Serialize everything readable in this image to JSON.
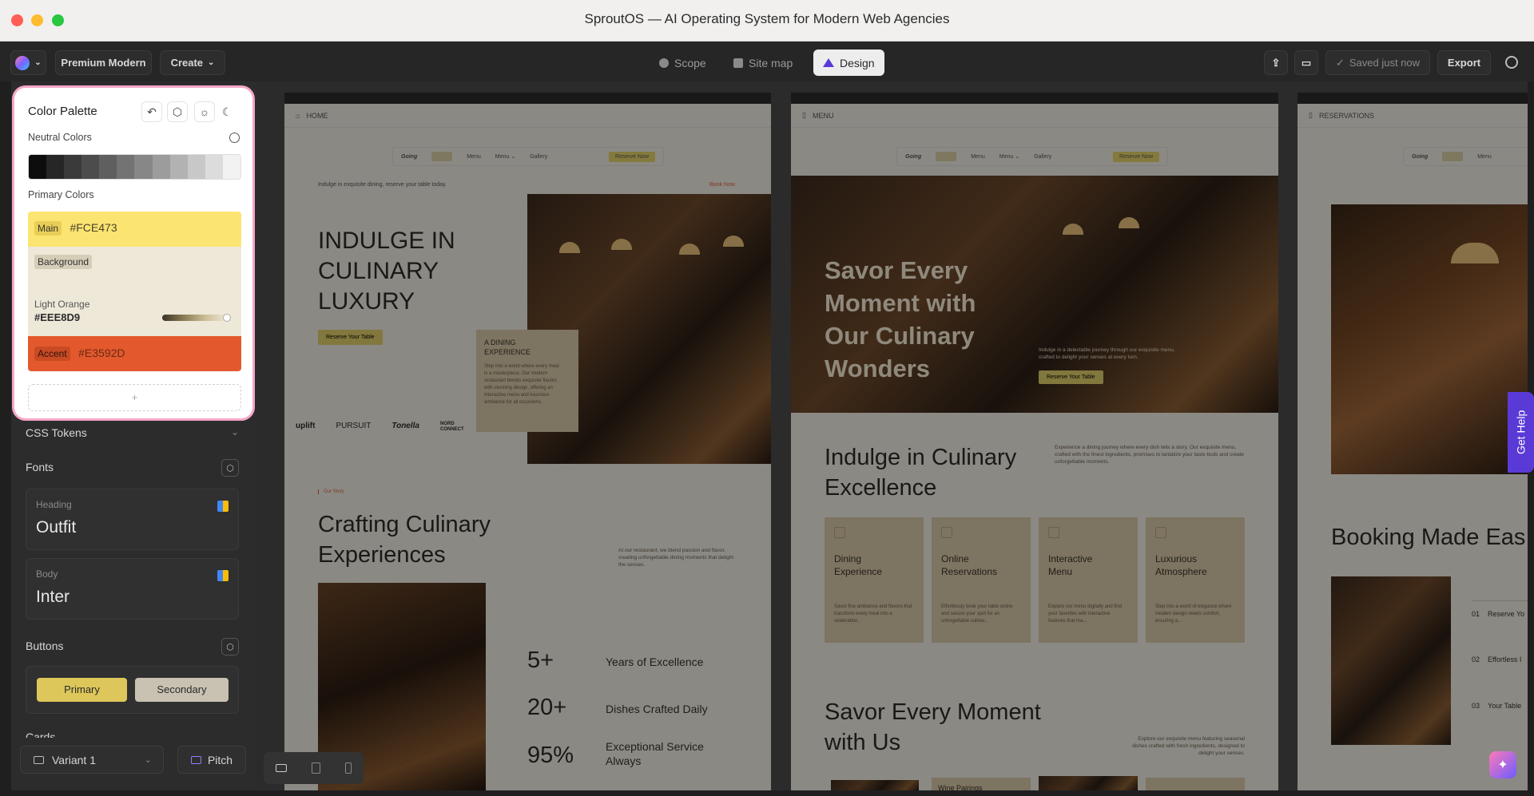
{
  "window": {
    "title": "SproutOS — AI Operating System for Modern Web Agencies"
  },
  "toolbar": {
    "theme_label": "Premium Modern",
    "create_label": "Create",
    "tabs": [
      "Scope",
      "Site map",
      "Design"
    ],
    "active_tab": "Design",
    "saved_label": "Saved just now",
    "export_label": "Export"
  },
  "palette": {
    "title": "Color Palette",
    "neutral_label": "Neutral Colors",
    "neutrals": [
      "#0d0d0d",
      "#262626",
      "#3a3a3a",
      "#4c4c4c",
      "#5f5f5f",
      "#737373",
      "#878787",
      "#9c9c9c",
      "#b2b2b2",
      "#c8c8c8",
      "#dcdcdc",
      "#f2f2f2"
    ],
    "primary_label": "Primary Colors",
    "main_pill": "Main",
    "main_hex": "#FCE473",
    "bg_pill": "Background",
    "bg_name": "Light Orange",
    "bg_hex": "#EEE8D9",
    "accent_pill": "Accent",
    "accent_hex": "#E3592D",
    "add_label": "+"
  },
  "sidebar": {
    "css_tokens": "CSS Tokens",
    "fonts": "Fonts",
    "heading_label": "Heading",
    "heading_font": "Outfit",
    "body_label": "Body",
    "body_font": "Inter",
    "buttons": "Buttons",
    "primary_btn": "Primary",
    "secondary_btn": "Secondary",
    "cards": "Cards",
    "variant_label": "Variant 1",
    "pitch_label": "Pitch"
  },
  "pages": {
    "home": {
      "tab": "HOME",
      "logo": "Going",
      "nav": [
        "Menu",
        "Menu ⌄",
        "Gallery"
      ],
      "cta": "Reserve Now",
      "note": "Indulge in exquisite dining, reserve your table today.",
      "book": "Book Now",
      "hero": "INDULGE IN CULINARY LUXURY",
      "hero_btn": "Reserve Your Table",
      "dining_title": "A DINING EXPERIENCE",
      "dining_body": "Step into a world where every meal is a masterpiece. Our modern restaurant blends exquisite flavors with stunning design, offering an interactive menu and luxurious ambiance for all occasions.",
      "brands": [
        "uplift",
        "PURSUIT",
        "Tonella",
        "NORD CONNECT"
      ],
      "story_tag": "Our Story",
      "craft_title": "Crafting Culinary Experiences",
      "craft_body": "At our restaurant, we blend passion and flavor, creating unforgettable dining moments that delight the senses.",
      "stats": [
        {
          "num": "5+",
          "label": "Years of Excellence"
        },
        {
          "num": "20+",
          "label": "Dishes Crafted Daily"
        },
        {
          "num": "95%",
          "label": "Exceptional Service Always"
        }
      ]
    },
    "menu": {
      "tab": "MENU",
      "logo": "Going",
      "nav": [
        "Menu",
        "Menu ⌄",
        "Gallery"
      ],
      "cta": "Reserve Now",
      "hero": "Savor Every Moment with Our Culinary Wonders",
      "hero_body": "Indulge in a delectable journey through our exquisite menu, crafted to delight your senses at every turn.",
      "hero_btn": "Reserve Your Table",
      "indulge_title": "Indulge in Culinary Excellence",
      "indulge_body": "Experience a dining journey where every dish tells a story. Our exquisite menu, crafted with the finest ingredients, promises to tantalize your taste buds and create unforgettable moments.",
      "features": [
        {
          "title": "Dining Experience",
          "body": "Savor fine ambiance and flavors that transform every meal into a celebration."
        },
        {
          "title": "Online Reservations",
          "body": "Effortlessly book your table online and secure your spot for an unforgettable culinar..."
        },
        {
          "title": "Interactive Menu",
          "body": "Explore our menu digitally and find your favorites with interactive features that ma..."
        },
        {
          "title": "Luxurious Atmosphere",
          "body": "Step into a world of elegance where modern design meets comfort, ensuring a..."
        }
      ],
      "savor_title": "Savor Every Moment with Us",
      "savor_body": "Explore our exquisite menu featuring seasonal dishes crafted with fresh ingredients, designed to delight your senses.",
      "wine": "Wine Pairings"
    },
    "reservations": {
      "tab": "RESERVATIONS",
      "logo": "Going",
      "nav": [
        "Menu"
      ],
      "booking_title": "Booking Made Eas",
      "steps": [
        {
          "num": "01",
          "label": "Reserve Yo"
        },
        {
          "num": "02",
          "label": "Effortless I"
        },
        {
          "num": "03",
          "label": "Your Table"
        }
      ]
    }
  },
  "help": {
    "label": "Get Help"
  }
}
